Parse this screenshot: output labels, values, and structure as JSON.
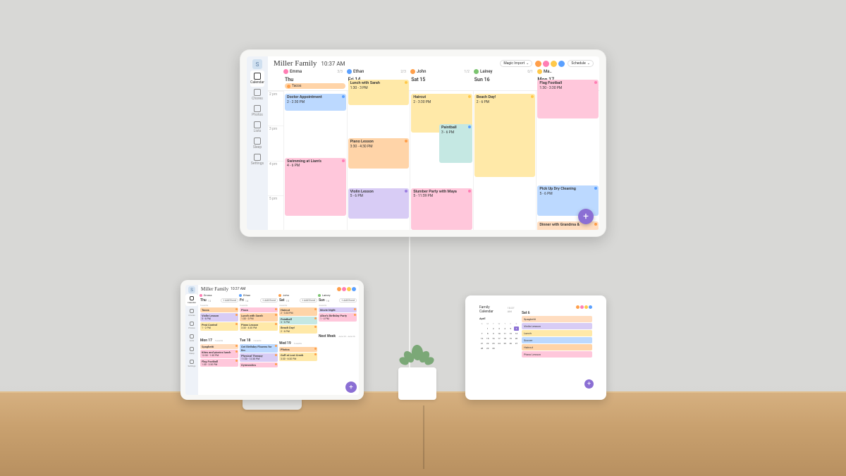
{
  "family_name": "Miller Family",
  "clock": "10:37 AM",
  "magic_import_label": "Magic Import",
  "schedule_label": "Schedule",
  "sidebar": {
    "logo": "S",
    "items": [
      "Calendar",
      "Chores",
      "Photos",
      "Lists",
      "Sleep",
      "Settings"
    ]
  },
  "people": [
    {
      "name": "Emma",
      "count": "3/3",
      "color": "d-pink"
    },
    {
      "name": "Ethan",
      "count": "2/3",
      "color": "d-blue"
    },
    {
      "name": "John",
      "count": "1/2",
      "color": "d-orange"
    },
    {
      "name": "Lainey",
      "count": "0/1",
      "color": "d-green"
    },
    {
      "name": "Ma..",
      "count": "",
      "color": "d-yellow"
    }
  ],
  "avatars": [
    "d-orange",
    "d-pink",
    "d-yellow",
    "d-blue"
  ],
  "days": [
    {
      "label": "Thu",
      "num": "",
      "meal": "Tacos",
      "meal_color": "c-orange"
    },
    {
      "label": "Fri 14",
      "num": "",
      "meal": "Pizza",
      "meal_color": "c-pink"
    },
    {
      "label": "Sat 15",
      "num": "",
      "meal": "",
      "meal_color": ""
    },
    {
      "label": "Sun 16",
      "num": "",
      "meal": "",
      "meal_color": ""
    },
    {
      "label": "Mon 17",
      "num": "",
      "meal": "Spaghetti",
      "meal_color": "c-peach"
    }
  ],
  "hours": [
    "2 pm",
    "3 pm",
    "4 pm",
    "5 pm"
  ],
  "events_large": {
    "thu": [
      {
        "title": "Doctor Appointment",
        "time": "2 - 2:30 PM",
        "top": "2%",
        "h": "12%",
        "cls": "c-blue",
        "dot": "d-blue"
      },
      {
        "title": "Swimming at Liam's",
        "time": "4 - 6 PM",
        "top": "48%",
        "h": "42%",
        "cls": "c-pink",
        "dot": "d-pink"
      }
    ],
    "fri": [
      {
        "title": "Lunch with Sarah",
        "time": "1:30 - 3 PM",
        "top": "-8%",
        "h": "18%",
        "cls": "c-yellow",
        "dot": "d-yellow"
      },
      {
        "title": "Piano Lesson",
        "time": "3:30 - 4:30 PM",
        "top": "34%",
        "h": "22%",
        "cls": "c-orange",
        "dot": "d-orange"
      },
      {
        "title": "Violin Lesson",
        "time": "5 - 6 PM",
        "top": "70%",
        "h": "22%",
        "cls": "c-purple",
        "dot": "d-purple"
      }
    ],
    "sat": [
      {
        "title": "Haircut",
        "time": "2 - 3:30 PM",
        "top": "2%",
        "h": "28%",
        "cls": "c-yellow",
        "dot": "d-yellow"
      },
      {
        "title": "Paintball",
        "time": "3 - 6 PM",
        "top": "24%",
        "h": "28%",
        "cls": "c-teal",
        "dot": "d-blue",
        "right": true
      },
      {
        "title": "Slumber Party with Maya",
        "time": "5 - 11:59 PM",
        "top": "70%",
        "h": "30%",
        "cls": "c-pink",
        "dot": "d-pink"
      }
    ],
    "sun": [
      {
        "title": "Beach Day!",
        "time": "2 - 6 PM",
        "top": "2%",
        "h": "60%",
        "cls": "c-yellow",
        "dot": "d-yellow"
      }
    ],
    "mon": [
      {
        "title": "Flag Football",
        "time": "1:30 - 3:30 PM",
        "top": "-8%",
        "h": "28%",
        "cls": "c-pink",
        "dot": "d-pink"
      },
      {
        "title": "Pick Up Dry Cleaning",
        "time": "5 - 6 PM",
        "top": "68%",
        "h": "22%",
        "cls": "c-blue",
        "dot": "d-blue"
      },
      {
        "title": "Dinner with Grandma &",
        "time": "",
        "top": "94%",
        "h": "10%",
        "cls": "c-peach",
        "dot": "d-orange"
      }
    ]
  },
  "tablet": {
    "title": "Miller Family",
    "time": "10:37 AM",
    "add_label": "+ Add Event",
    "columns": [
      {
        "day": "Thu",
        "num": "13",
        "sub": "5 events",
        "rows": [
          {
            "t": "Tacos",
            "s": "",
            "c": "c-orange"
          },
          {
            "t": "Violin Lesson",
            "s": "5 - 6 PM",
            "c": "c-purple"
          },
          {
            "t": "Pest Control",
            "s": "1 - 2 PM",
            "c": "c-yellow"
          },
          {
            "t": "",
            "s": "",
            "c": ""
          },
          {
            "head": "Mon 17",
            "sub": "5 events"
          },
          {
            "t": "Spaghetti",
            "s": "",
            "c": "c-peach"
          },
          {
            "t": "Kites and picnics lunch",
            "s": "12:30 - 1:30 PM",
            "c": "c-pink"
          },
          {
            "t": "Flag Football",
            "s": "1:30 - 2:30 PM",
            "c": "c-pink"
          }
        ]
      },
      {
        "day": "Fri",
        "num": "14",
        "sub": "6 events",
        "rows": [
          {
            "t": "Pizza",
            "s": "",
            "c": "c-pink"
          },
          {
            "t": "Lunch with Sarah",
            "s": "1:30 - 3 PM",
            "c": "c-orange"
          },
          {
            "t": "Piano Lesson",
            "s": "3:30 - 4:30 PM",
            "c": "c-yellow"
          },
          {
            "t": "",
            "s": "",
            "c": ""
          },
          {
            "head": "Tue 18",
            "sub": "4 events"
          },
          {
            "t": "Get Birthday Flowers for Em",
            "s": "",
            "c": "c-blue"
          },
          {
            "t": "Physical Therapy",
            "s": "11:30 - 12:30 PM",
            "c": "c-purple"
          },
          {
            "t": "Gymnastics",
            "s": "",
            "c": "c-pink"
          }
        ]
      },
      {
        "day": "Sat",
        "num": "15",
        "sub": "4 events",
        "rows": [
          {
            "t": "Haircut",
            "s": "2 - 3:30 PM",
            "c": "c-orange"
          },
          {
            "t": "Paintball",
            "s": "3 - 6 PM",
            "c": "c-teal"
          },
          {
            "t": "Beach Day!",
            "s": "2 - 6 PM",
            "c": "c-yellow"
          },
          {
            "t": "",
            "s": "",
            "c": ""
          },
          {
            "head": "Wed 19",
            "sub": "3 events"
          },
          {
            "t": "Photos",
            "s": "",
            "c": "c-orange"
          },
          {
            "t": "Golf at Lost Creek",
            "s": "3:30 - 6:30 PM",
            "c": "c-yellow"
          },
          {
            "t": "",
            "s": "",
            "c": ""
          }
        ]
      },
      {
        "day": "Sun",
        "num": "16",
        "sub": "4 events",
        "rows": [
          {
            "t": "Movie Night",
            "s": "",
            "c": "c-purple"
          },
          {
            "t": "Alice's Birthday Party",
            "s": "1 - 4 PM",
            "c": "c-pink"
          },
          {
            "t": "",
            "s": "",
            "c": ""
          },
          {
            "t": "",
            "s": "",
            "c": ""
          },
          {
            "head": "Next Week",
            "sub": "June 20 - June 26"
          }
        ]
      }
    ]
  },
  "small": {
    "title": "Family Calendar",
    "time": "10:37 AM",
    "month": "April",
    "dow": [
      "S",
      "M",
      "T",
      "W",
      "T",
      "F",
      "S"
    ],
    "dates": [
      "",
      "1",
      "2",
      "3",
      "4",
      "5",
      "6",
      "7",
      "8",
      "9",
      "10",
      "11",
      "12",
      "13",
      "14",
      "15",
      "16",
      "17",
      "18",
      "19",
      "20",
      "21",
      "22",
      "23",
      "24",
      "25",
      "26",
      "27",
      "28",
      "29",
      "30",
      "",
      "",
      ""
    ],
    "day_label": "Sat 6",
    "events": [
      {
        "t": "Spaghetti",
        "c": "c-peach"
      },
      {
        "t": "Violin Lesson",
        "c": "c-purple"
      },
      {
        "t": "Lunch",
        "c": "c-yellow"
      },
      {
        "t": "Soccer",
        "c": "c-blue"
      },
      {
        "t": "Haircut",
        "c": "c-orange"
      },
      {
        "t": "Piano Lesson",
        "c": "c-pink"
      }
    ]
  }
}
